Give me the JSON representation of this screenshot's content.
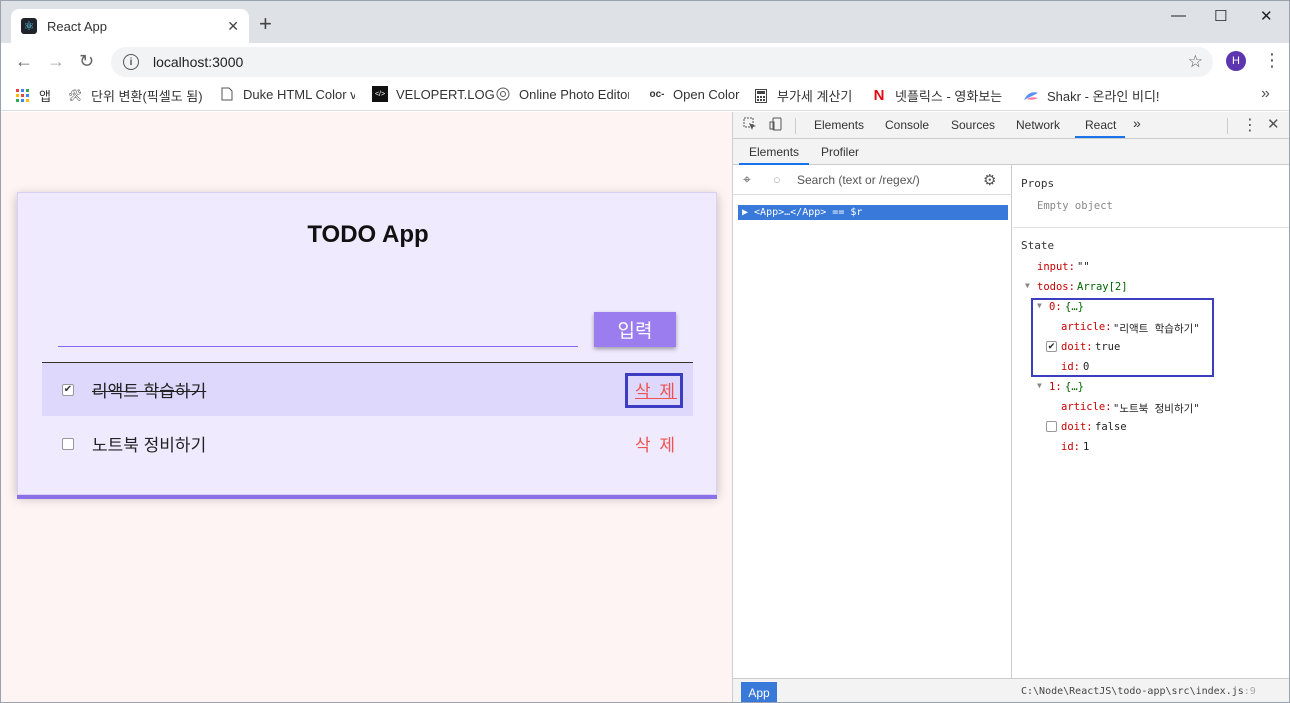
{
  "browser": {
    "tab_title": "React App",
    "tab_close": "✕",
    "new_tab": "+",
    "url": "localhost:3000",
    "avatar_initial": "H",
    "window_controls": {
      "minimize": "—",
      "maximize": "☐",
      "close": "✕"
    },
    "bookmarks": [
      {
        "label": "앱",
        "icon": "apps-grid-icon"
      },
      {
        "label": "단위 변환(픽셀도 됨)",
        "icon": "tool-icon"
      },
      {
        "label": "Duke HTML Color vC",
        "icon": "page-icon"
      },
      {
        "label": "VELOPERT.LOG",
        "icon": "velopert-icon"
      },
      {
        "label": "Online Photo Editor",
        "icon": "camera-icon"
      },
      {
        "label": "Open Color",
        "icon": "oc-icon"
      },
      {
        "label": "부가세 계산기",
        "icon": "calculator-icon"
      },
      {
        "label": "넷플릭스 - 영화보는",
        "icon": "netflix-icon"
      },
      {
        "label": "Shakr - 온라인 비디!",
        "icon": "shakr-icon"
      }
    ],
    "bookmarks_more": "»"
  },
  "app": {
    "title": "TODO App",
    "input_value": "",
    "submit_label": "입력",
    "todos": [
      {
        "article": "리액트 학습하기",
        "doit": true,
        "delete_label": "삭 제"
      },
      {
        "article": "노트북 정비하기",
        "doit": false,
        "delete_label": "삭 제"
      }
    ]
  },
  "devtools": {
    "tabs": [
      "Elements",
      "Console",
      "Sources",
      "Network",
      "React"
    ],
    "active_tab": "React",
    "more_tabs": "»",
    "subtabs": [
      "Elements",
      "Profiler"
    ],
    "search_placeholder": "Search (text or /regex/)",
    "selected_node": "▶ <App>…</App> == $r",
    "props_header": "Props",
    "props_empty": "Empty object",
    "state_header": "State",
    "state": {
      "input_key": "input:",
      "input_val": "\"\"",
      "todos_key": "todos:",
      "todos_val": "Array[2]",
      "item0_key": "0:",
      "item0_val": "{…}",
      "item0_article_key": "article:",
      "item0_article_val": "\"리액트 학습하기\"",
      "item0_doit_key": "doit:",
      "item0_doit_val": "true",
      "item0_id_key": "id:",
      "item0_id_val": "0",
      "item1_key": "1:",
      "item1_val": "{…}",
      "item1_article_key": "article:",
      "item1_article_val": "\"노트북 정비하기\"",
      "item1_doit_key": "doit:",
      "item1_doit_val": "false",
      "item1_id_key": "id:",
      "item1_id_val": "1"
    },
    "bottom_component": "App",
    "source_path": "C:\\Node\\ReactJS\\todo-app\\src\\index.js",
    "source_line": ":9"
  },
  "colors": {
    "accent": "#9b7df0",
    "delete": "#ef5350",
    "highlight_box": "#3c3dc0",
    "devtools_selection": "#3879d9"
  }
}
